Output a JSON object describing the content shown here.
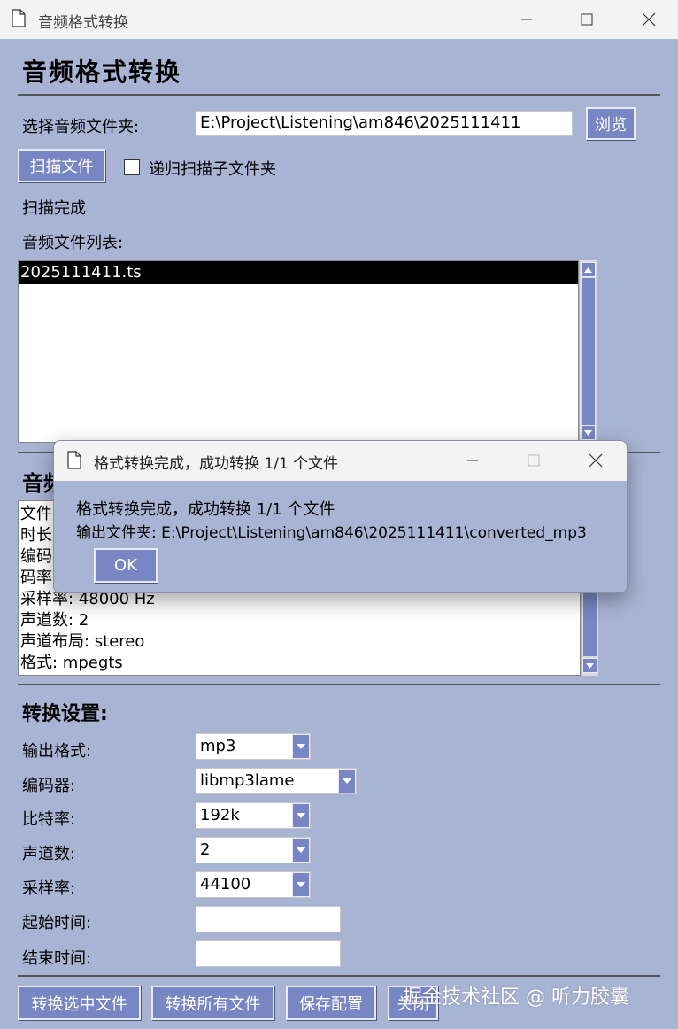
{
  "window": {
    "title": "音频格式转换"
  },
  "heading": "音频格式转换",
  "folder": {
    "label": "选择音频文件夹:",
    "value": "E:\\Project\\Listening\\am846\\2025111411",
    "browse_label": "浏览"
  },
  "scan": {
    "button_label": "扫描文件",
    "recursive_label": "递归扫描子文件夹",
    "recursive_checked": false,
    "status": "扫描完成"
  },
  "file_list": {
    "label": "音频文件列表:",
    "items": [
      "2025111411.ts"
    ],
    "selected_index": 0
  },
  "audio_info": {
    "heading_visible": "音频",
    "lines": [
      "文件",
      "时长",
      "编码",
      "码率",
      "采样率: 48000 Hz",
      "声道数: 2",
      "声道布局: stereo",
      "格式: mpegts"
    ]
  },
  "settings": {
    "heading": "转换设置:",
    "output_format": {
      "label": "输出格式:",
      "value": "mp3"
    },
    "encoder": {
      "label": "编码器:",
      "value": "libmp3lame"
    },
    "bitrate": {
      "label": "比特率:",
      "value": "192k"
    },
    "channels": {
      "label": "声道数:",
      "value": "2"
    },
    "sample_rate": {
      "label": "采样率:",
      "value": "44100"
    },
    "start_time": {
      "label": "起始时间:",
      "value": ""
    },
    "end_time": {
      "label": "结束时间:",
      "value": ""
    }
  },
  "actions": {
    "convert_selected": "转换选中文件",
    "convert_all": "转换所有文件",
    "save_config": "保存配置",
    "close": "关闭"
  },
  "dialog": {
    "title": "格式转换完成，成功转换 1/1 个文件",
    "message_line1": "格式转换完成，成功转换 1/1 个文件",
    "message_line2": "输出文件夹: E:\\Project\\Listening\\am846\\2025111411\\converted_mp3",
    "ok_label": "OK"
  },
  "watermark": "掘金技术社区 @ 听力胶囊",
  "colors": {
    "background": "#a9b4d4",
    "accent": "#7886c4",
    "titlebar": "#f3f3f3"
  },
  "icons": [
    "document-icon",
    "minimize-icon",
    "maximize-icon",
    "close-icon",
    "chevron-down-icon",
    "scroll-up-arrow-icon",
    "scroll-down-arrow-icon"
  ]
}
